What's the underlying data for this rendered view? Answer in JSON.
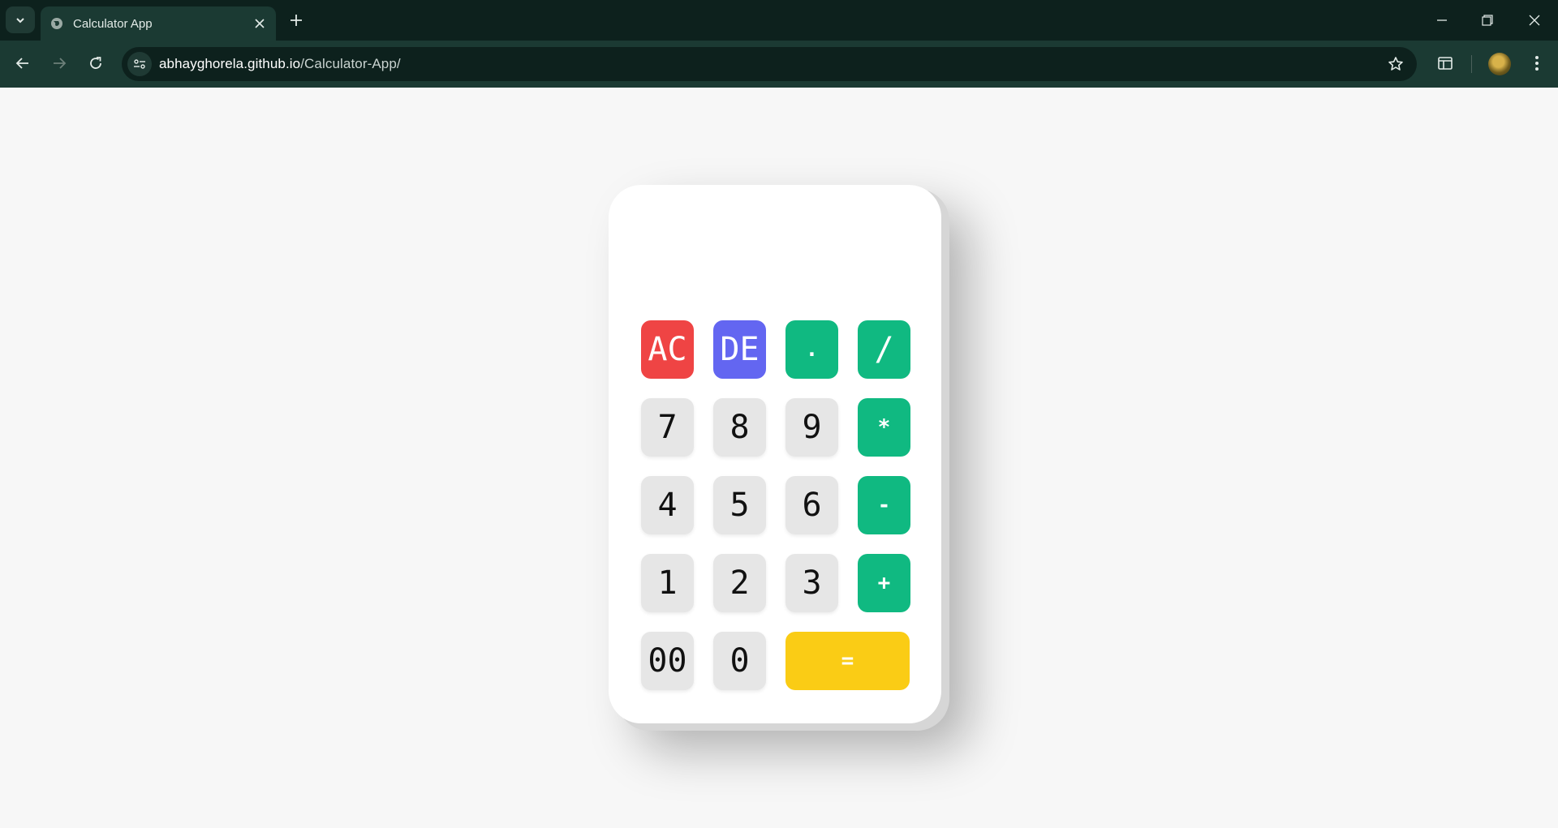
{
  "browser": {
    "tab_title": "Calculator App",
    "url_host": "abhayghorela.github.io",
    "url_path": "/Calculator-App/",
    "icons": [
      "tab-search-icon",
      "globe-icon",
      "close-icon",
      "plus-icon",
      "minimize-icon",
      "restore-icon",
      "close-window-icon",
      "back-icon",
      "forward-icon",
      "reload-icon",
      "site-info-icon",
      "star-icon",
      "side-panel-icon",
      "avatar",
      "more-menu-icon"
    ]
  },
  "calculator": {
    "display_value": "",
    "row1": {
      "ac": "AC",
      "de": "DE",
      "dot": ".",
      "divide": "/"
    },
    "row2": {
      "seven": "7",
      "eight": "8",
      "nine": "9",
      "multiply": "*"
    },
    "row3": {
      "four": "4",
      "five": "5",
      "six": "6",
      "minus": "-"
    },
    "row4": {
      "one": "1",
      "two": "2",
      "three": "3",
      "plus": "+"
    },
    "row5": {
      "double_zero": "00",
      "zero": "0",
      "equals": "="
    }
  },
  "colors": {
    "clear": "#ef4444",
    "delete": "#6366f1",
    "operator": "#10b981",
    "equals": "#facc15",
    "number": "#e6e6e6",
    "page_bg": "#f7f7f7"
  }
}
